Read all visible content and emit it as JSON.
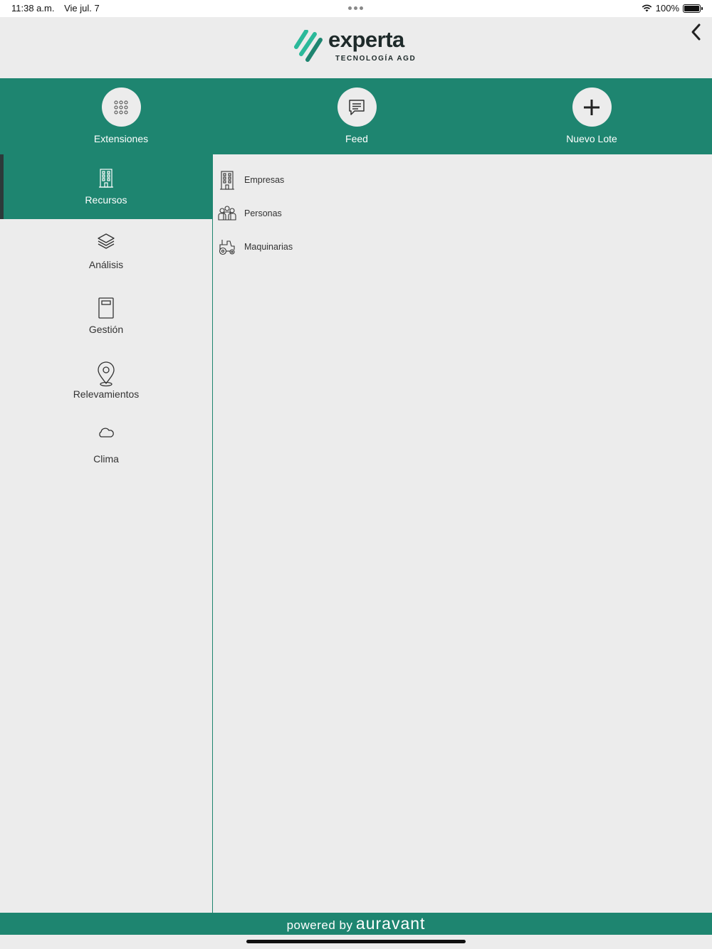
{
  "status_bar": {
    "time": "11:38 a.m.",
    "date": "Vie jul. 7",
    "battery": "100%"
  },
  "header": {
    "logo_word": "experta",
    "logo_sub_1": "TECNOLOGÍA ",
    "logo_sub_2": "AGD",
    "back_icon": "chevron-left-icon"
  },
  "actions": [
    {
      "label": "Extensiones",
      "icon": "grid-dots-icon"
    },
    {
      "label": "Feed",
      "icon": "chat-icon"
    },
    {
      "label": "Nuevo Lote",
      "icon": "plus-icon"
    }
  ],
  "sidebar": {
    "items": [
      {
        "label": "Recursos",
        "icon": "building-icon",
        "active": true
      },
      {
        "label": "Análisis",
        "icon": "layers-icon"
      },
      {
        "label": "Gestión",
        "icon": "panel-icon"
      },
      {
        "label": "Relevamientos",
        "icon": "map-pin-icon"
      },
      {
        "label": "Clima",
        "icon": "cloud-icon"
      }
    ]
  },
  "content": {
    "items": [
      {
        "label": "Empresas",
        "icon": "building-icon"
      },
      {
        "label": "Personas",
        "icon": "people-icon"
      },
      {
        "label": "Maquinarias",
        "icon": "tractor-icon"
      }
    ]
  },
  "footer": {
    "powered": "powered by",
    "brand": "auravant"
  },
  "colors": {
    "primary": "#1e8570",
    "background": "#ececec",
    "logo_teal": "#2bb99a"
  }
}
